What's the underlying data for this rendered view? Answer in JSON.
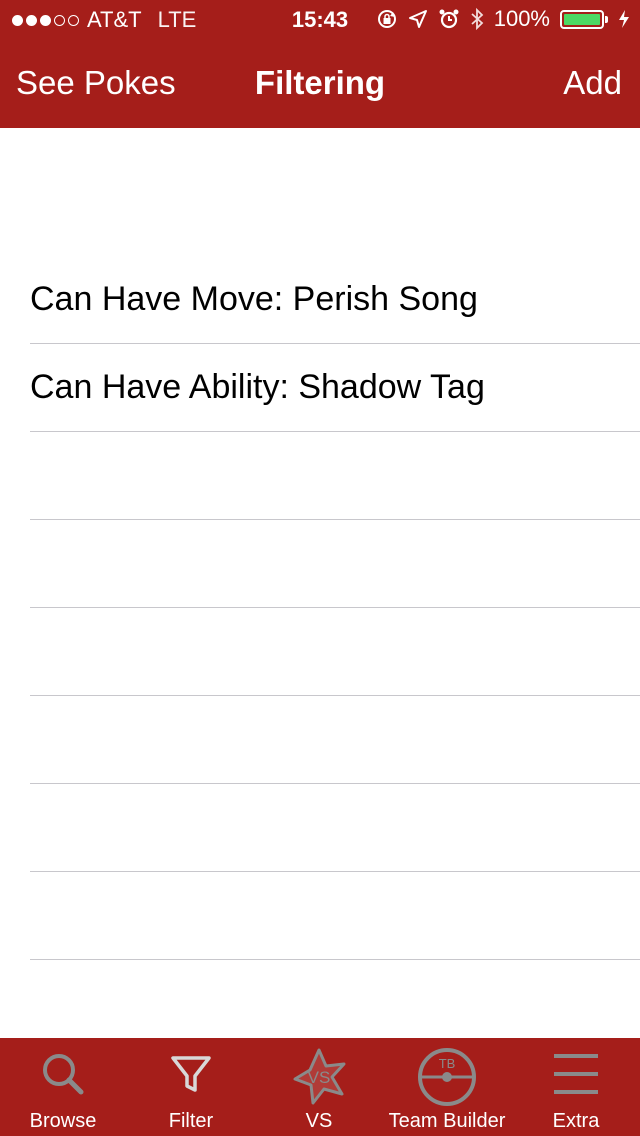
{
  "status_bar": {
    "carrier": "AT&T",
    "network": "LTE",
    "time": "15:43",
    "battery": "100%",
    "battery_color": "#4cd964"
  },
  "nav": {
    "left_button": "See Pokes",
    "title": "Filtering",
    "right_button": "Add"
  },
  "filters": [
    {
      "label": "Can Have Move: Perish Song"
    },
    {
      "label": "Can Have Ability: Shadow Tag"
    },
    {
      "label": ""
    },
    {
      "label": ""
    },
    {
      "label": ""
    },
    {
      "label": ""
    },
    {
      "label": ""
    },
    {
      "label": ""
    },
    {
      "label": ""
    }
  ],
  "tabs": [
    {
      "label": "Browse",
      "icon": "magnifier-icon"
    },
    {
      "label": "Filter",
      "icon": "funnel-icon"
    },
    {
      "label": "VS",
      "icon": "vs-star-icon",
      "icon_text": "VS"
    },
    {
      "label": "Team Builder",
      "icon": "pokeball-icon",
      "icon_text": "TB"
    },
    {
      "label": "Extra",
      "icon": "hamburger-icon"
    }
  ],
  "colors": {
    "brand": "#a51e1a",
    "tab_icon": "#8a8a8a"
  }
}
